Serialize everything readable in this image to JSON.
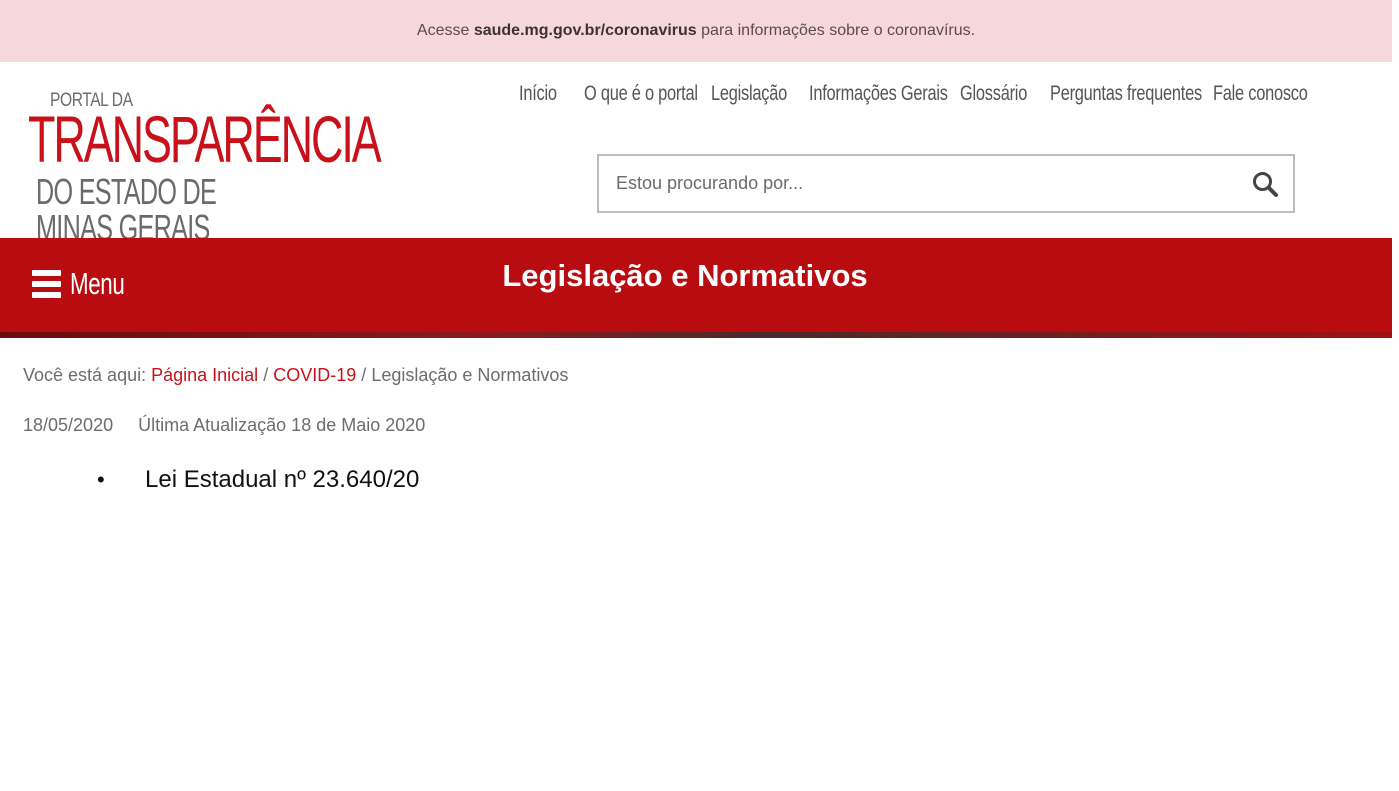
{
  "notice": {
    "prefix": "Acesse",
    "link": "saude.mg.gov.br/coronavirus",
    "suffix": "para informações sobre o coronavírus."
  },
  "logo": {
    "line1": "PORTAL DA",
    "line2": "TRANSPARÊNCIA",
    "line3": "DO ESTADO DE MINAS GERAIS"
  },
  "nav": {
    "items": [
      {
        "label": "Início"
      },
      {
        "label": "O que é o portal"
      },
      {
        "label": "Legislação"
      },
      {
        "label": "Informações Gerais"
      },
      {
        "label": "Glossário"
      },
      {
        "label": "Perguntas frequentes"
      },
      {
        "label": "Fale conosco"
      }
    ]
  },
  "search": {
    "placeholder": "Estou procurando por...",
    "value": "",
    "icon": "search-icon"
  },
  "banner": {
    "menu_label": "Menu",
    "menu_icon": "hamburger-icon",
    "title": "Legislação e Normativos",
    "color": "#b90c10"
  },
  "breadcrumb": {
    "prefix": "Você está aqui:",
    "home": "Página Inicial",
    "sep1": "/",
    "section": "COVID-19",
    "sep2": "/",
    "current": "Legislação e Normativos"
  },
  "meta": {
    "date": "18/05/2020",
    "updated": "Última Atualização 18 de Maio 2020"
  },
  "content": {
    "items": [
      {
        "bullet": "•",
        "label": "Lei Estadual nº 23.640/20"
      }
    ]
  }
}
